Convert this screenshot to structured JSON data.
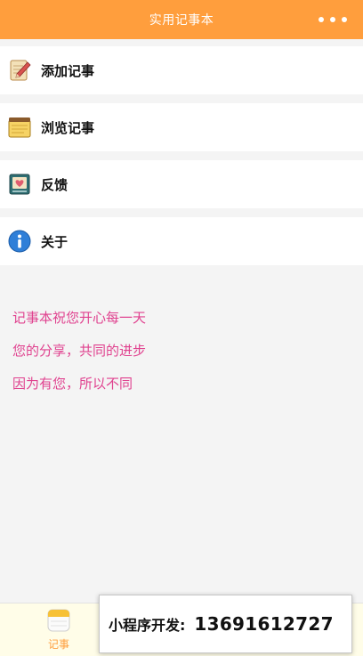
{
  "header": {
    "title": "实用记事本",
    "more_icon": "more-dots-icon"
  },
  "menu": {
    "items": [
      {
        "label": "添加记事",
        "icon": "notepad-pencil-icon"
      },
      {
        "label": "浏览记事",
        "icon": "notebook-icon"
      },
      {
        "label": "反馈",
        "icon": "heart-book-icon"
      },
      {
        "label": "关于",
        "icon": "info-icon"
      }
    ]
  },
  "messages": [
    "记事本祝您开心每一天",
    "您的分享，共同的进步",
    "因为有您，所以不同"
  ],
  "tabbar": {
    "tabs": [
      {
        "label": "记事",
        "icon": "notes-app-icon"
      }
    ]
  },
  "banner": {
    "label": "小程序开发:",
    "phone": "13691612727"
  },
  "colors": {
    "header": "#ff9e3d",
    "message": "#e0428f",
    "tab_active": "#ff9e3d"
  }
}
